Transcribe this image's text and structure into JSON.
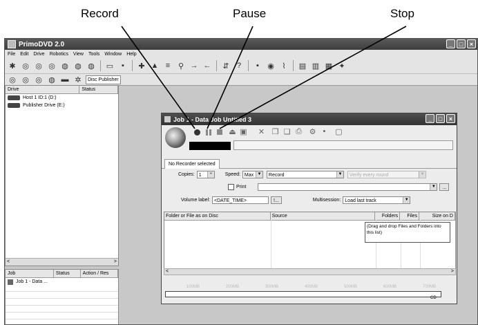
{
  "callouts": {
    "record": "Record",
    "pause": "Pause",
    "stop": "Stop"
  },
  "app": {
    "title": "PrimoDVD 2.0",
    "menu": [
      "File",
      "Edit",
      "Drive",
      "Robotics",
      "View",
      "Tools",
      "Window",
      "Help"
    ],
    "publisher_label": "Disc Publisher"
  },
  "drives": {
    "headers": [
      "Drive",
      "Status"
    ],
    "rows": [
      "Host 1 ID:1 (D:)",
      "Publisher Drive (E:)"
    ]
  },
  "jobs": {
    "headers": [
      "Job",
      "Status",
      "Action / Res"
    ],
    "rows": [
      "Job 1 - Data ..."
    ]
  },
  "job_window": {
    "title": "Job 1 - Data Job Untitled 3",
    "tab": "No Recorder selected",
    "copies_label": "Copies:",
    "copies_value": "1",
    "speed_label": "Speed:",
    "speed_value": "Max",
    "mode_value": "Record",
    "verify_value": "Verify every round",
    "print_label": "Print",
    "volume_label": "Volume label:",
    "volume_value": "<DATE_TIME>",
    "volume_btn": "!...",
    "multisession_label": "Multisession:",
    "multisession_value": "Load last track",
    "file_headers": [
      "Folder or File as on Disc",
      "Source",
      "Folders",
      "Files",
      "Size on D"
    ],
    "hint": "(Drag and drop Files and Folders into this list)",
    "capacity_marks": [
      "100MB",
      "200MB",
      "300MB",
      "400MB",
      "500MB",
      "600MB",
      "700MB"
    ],
    "media_label": "CD"
  },
  "colors": {
    "titlebar": "#444444",
    "workspace": "#c8c8c8"
  }
}
